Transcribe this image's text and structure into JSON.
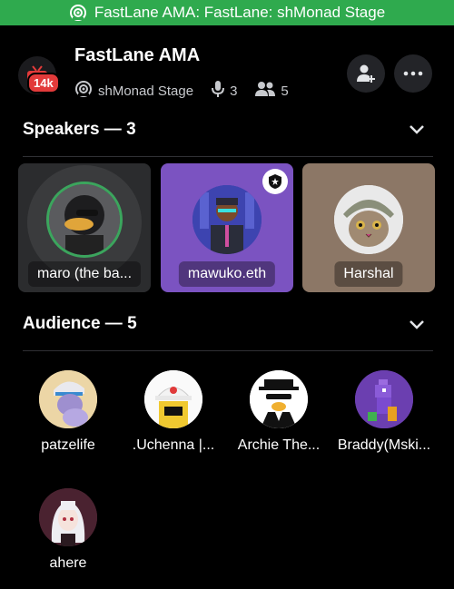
{
  "banner": {
    "text": "FastLane AMA: FastLane: shMonad Stage",
    "icon": "stage-icon"
  },
  "header": {
    "title": "FastLane AMA",
    "badge": "14k",
    "stage_name": "shMonad Stage",
    "speaker_count": "3",
    "listener_count": "5",
    "invite_icon": "add-user-icon",
    "more_icon": "more-dots-icon"
  },
  "speakers": {
    "title": "Speakers — 3",
    "items": [
      {
        "name": "maro (the ba...",
        "moderator": false,
        "bg": "#2b2c2e"
      },
      {
        "name": "mawuko.eth",
        "moderator": true,
        "bg": "#7b53c1"
      },
      {
        "name": "Harshal",
        "moderator": false,
        "bg": "#8c7766"
      }
    ]
  },
  "audience": {
    "title": "Audience — 5",
    "items": [
      {
        "name": "patzelife"
      },
      {
        "name": ".Uchenna |..."
      },
      {
        "name": "Archie The..."
      },
      {
        "name": "Braddy(Mski..."
      },
      {
        "name": "ahere"
      }
    ]
  },
  "colors": {
    "banner": "#2faa4e",
    "accent_green": "#3ba55d",
    "badge_red": "#e23a3a"
  }
}
